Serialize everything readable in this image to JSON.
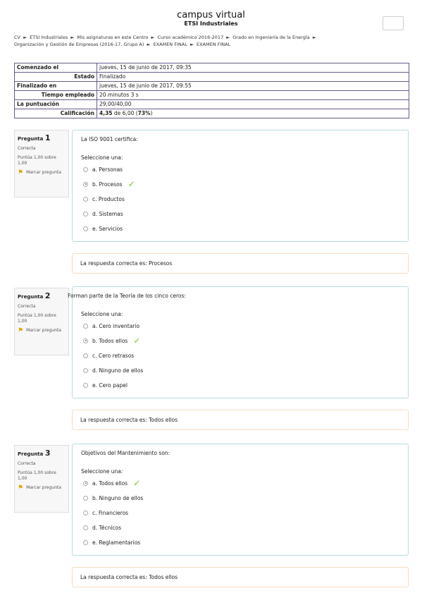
{
  "header": {
    "title": "campus virtual",
    "subtitle": "ETSI Industriales"
  },
  "breadcrumb": {
    "items": [
      "CV",
      "ETSI Industriales",
      "Mis asignaturas en este Centro",
      "Curso académico 2016-2017",
      "Grado en Ingeniería de la Energía",
      "Organización y Gestión de Empresas (2016-17, Grupo A)",
      "EXAMEN FINAL",
      "EXAMEN FINAL"
    ],
    "separator": "►"
  },
  "summary": {
    "rows": [
      {
        "label": "Comenzado el",
        "value": "jueves, 15 de junio de 2017, 09:35"
      },
      {
        "label": "Estado",
        "value": "Finalizado"
      },
      {
        "label": "Finalizado en",
        "value": "jueves, 15 de junio de 2017, 09:55"
      },
      {
        "label": "Tiempo empleado",
        "value": "20 minutos 3 s"
      },
      {
        "label": "La puntuación",
        "value": "29,00/40,00"
      },
      {
        "label": "Calificación",
        "value_bold": "4,35",
        "value_mid": " de 6,00 (",
        "value_pct": "73%",
        "value_end": ")"
      }
    ]
  },
  "questions": [
    {
      "label": "Pregunta",
      "number": "1",
      "status": "Correcta",
      "score": "Puntúa 1,00 sobre 1,00",
      "flag_label": "Marcar pregunta",
      "text": "La ISO 9001 certifica:",
      "prompt": "Seleccione una:",
      "options": [
        "a. Personas",
        "b. Procesos",
        "c. Productos",
        "d. Sistemas",
        "e. Servicios"
      ],
      "selected_index": 1,
      "feedback": "La respuesta correcta es: Procesos"
    },
    {
      "label": "Pregunta",
      "number": "2",
      "status": "Correcta",
      "score": "Puntúa 1,00 sobre 1,00",
      "flag_label": "Marcar pregunta",
      "text": "Forman parte de la Teoría de los cinco ceros:",
      "prompt": "Seleccione una:",
      "options": [
        "a. Cero inventario",
        "b. Todos ellos",
        "c. Cero retrasos",
        "d. Ninguno de ellos",
        "e. Cero papel"
      ],
      "selected_index": 1,
      "feedback": "La respuesta correcta es: Todos ellos"
    },
    {
      "label": "Pregunta",
      "number": "3",
      "status": "Correcta",
      "score": "Puntúa 1,00 sobre 1,00",
      "flag_label": "Marcar pregunta",
      "text": "Objetivos del Mantenimiento son:",
      "prompt": "Seleccione una:",
      "options": [
        "a. Todos ellos",
        "b. Ninguno de ellos",
        "c. Financieros",
        "d. Técnicos",
        "e. Reglamentarios"
      ],
      "selected_index": 0,
      "feedback": "La respuesta correcta es: Todos ellos"
    }
  ],
  "colors": {
    "table_border": "#6a5a8c",
    "question_border": "#b9dbe3",
    "feedback_border": "#f5dcc0",
    "check": "#7cbf2a",
    "flag": "#e0a400"
  },
  "icons": {
    "check": "check-icon",
    "flag": "flag-icon"
  }
}
